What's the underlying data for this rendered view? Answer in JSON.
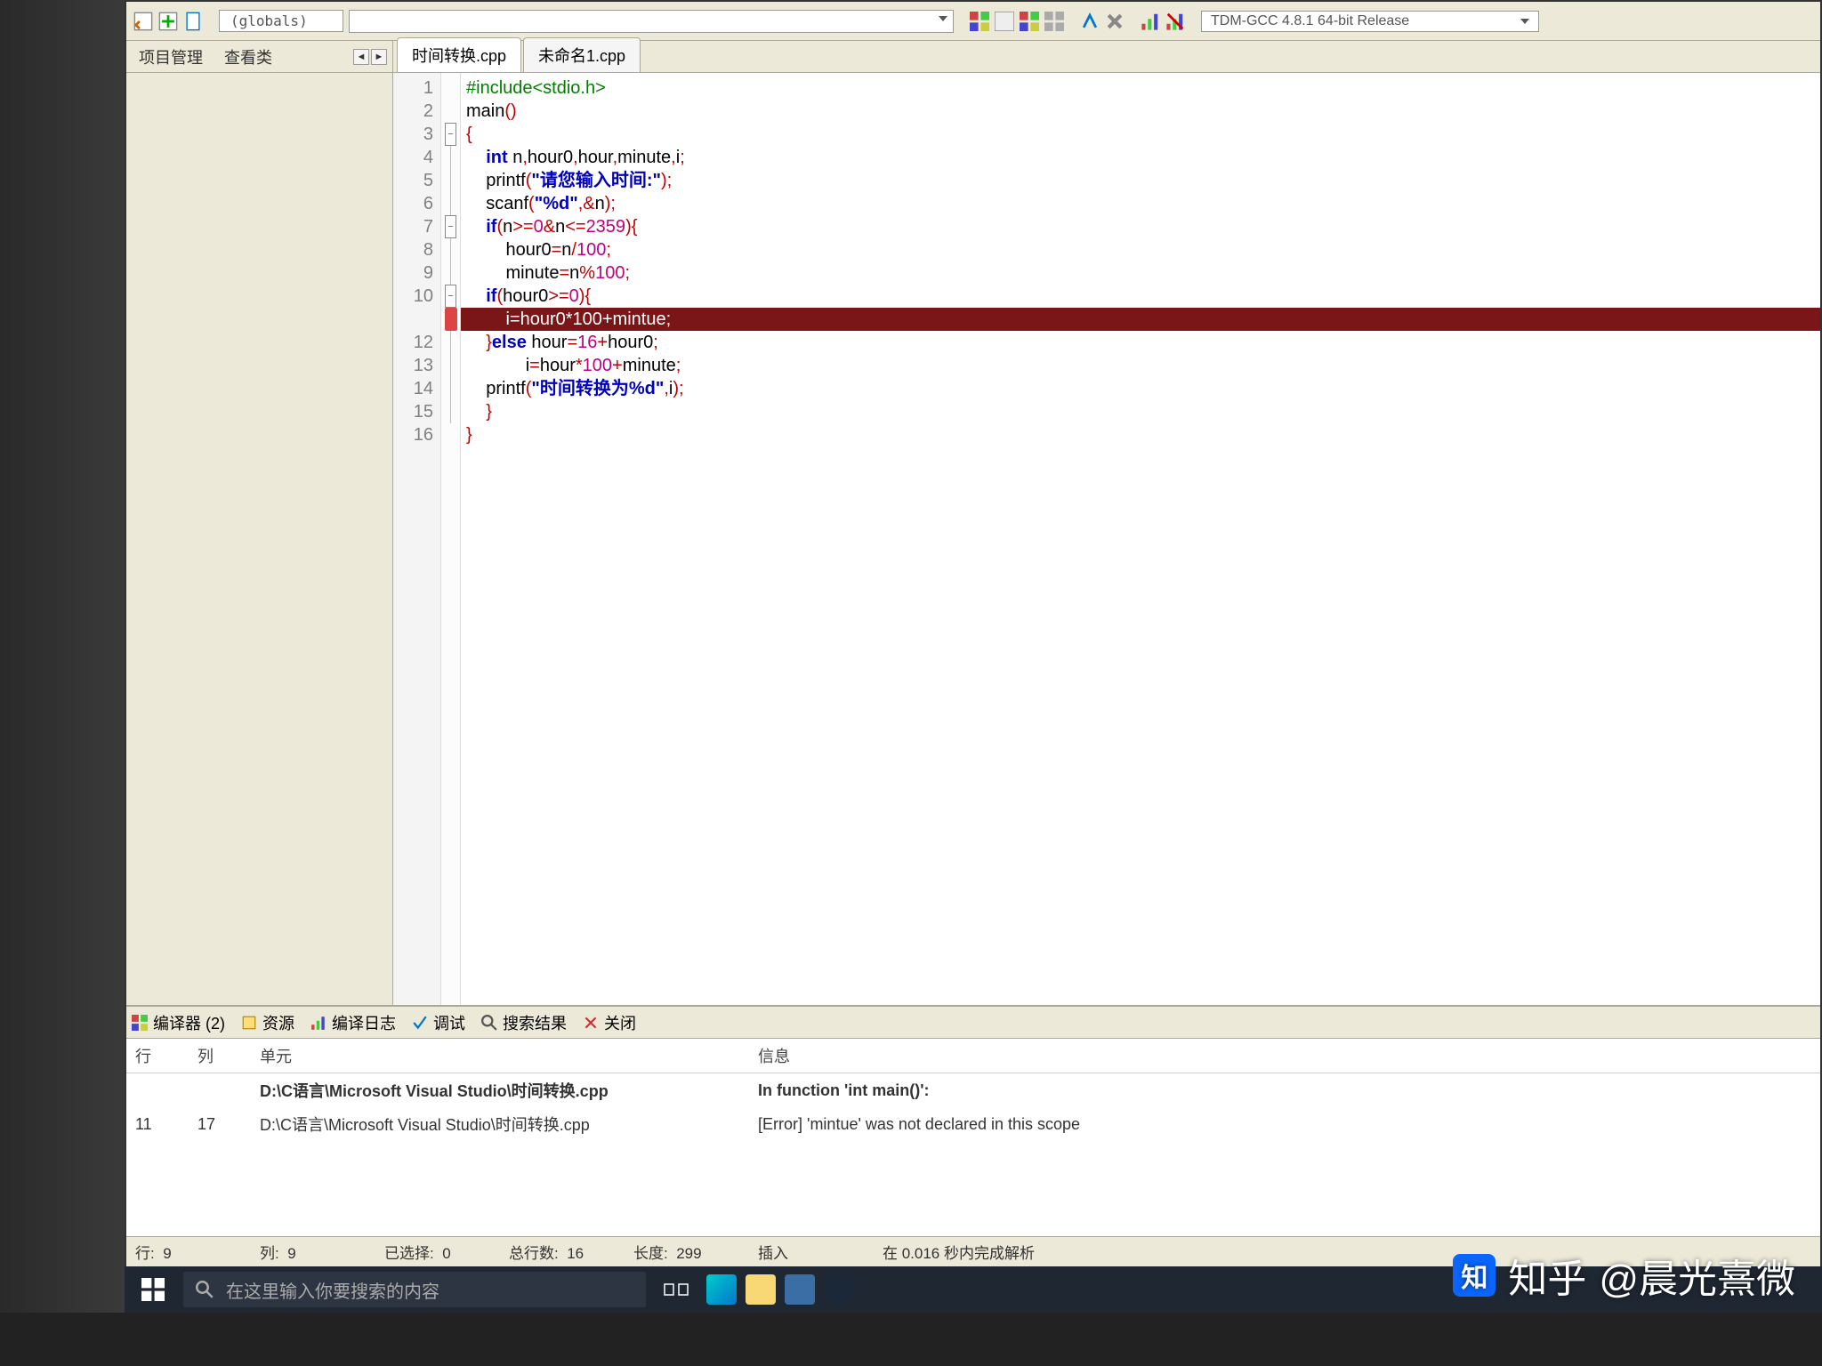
{
  "toolbar": {
    "globals": "(globals)",
    "compiler": "TDM-GCC 4.8.1 64-bit Release"
  },
  "sidebar": {
    "tab1": "项目管理",
    "tab2": "查看类"
  },
  "tabs": {
    "active": "时间转换.cpp",
    "other": "未命名1.cpp"
  },
  "code": {
    "lines": [
      {
        "n": "1",
        "fold": "",
        "html": "<span class='pp'>#include&lt;stdio.h&gt;</span>"
      },
      {
        "n": "2",
        "fold": "",
        "html": "<span class='fn'>main</span><span class='br'>()</span>"
      },
      {
        "n": "3",
        "fold": "box",
        "html": "<span class='br'>{</span>"
      },
      {
        "n": "4",
        "fold": "line",
        "html": "    <span class='kw'>int</span> <span class='id'>n</span><span class='op'>,</span><span class='id'>hour0</span><span class='op'>,</span><span class='id'>hour</span><span class='op'>,</span><span class='id'>minute</span><span class='op'>,</span><span class='id'>i</span><span class='op'>;</span>"
      },
      {
        "n": "5",
        "fold": "line",
        "html": "    <span class='fn'>printf</span><span class='br'>(</span><span class='str'>\"请您输入时间:\"</span><span class='br'>)</span><span class='op'>;</span>"
      },
      {
        "n": "6",
        "fold": "line",
        "html": "    <span class='fn'>scanf</span><span class='br'>(</span><span class='str'>\"%d\"</span><span class='op'>,&amp;</span><span class='id'>n</span><span class='br'>)</span><span class='op'>;</span>"
      },
      {
        "n": "7",
        "fold": "box",
        "html": "    <span class='kw'>if</span><span class='br'>(</span><span class='id'>n</span><span class='op'>&gt;=</span><span class='num'>0</span><span class='op'>&amp;</span><span class='id'>n</span><span class='op'>&lt;=</span><span class='num'>2359</span><span class='br'>){</span>"
      },
      {
        "n": "8",
        "fold": "line",
        "html": "        <span class='id'>hour0</span><span class='op'>=</span><span class='id'>n</span><span class='op'>/</span><span class='num'>100</span><span class='op'>;</span>"
      },
      {
        "n": "9",
        "fold": "line",
        "html": "        <span class='id'>minute</span><span class='op'>=</span><span class='id'>n</span><span class='op'>%</span><span class='num'>100</span><span class='op'>;</span>"
      },
      {
        "n": "10",
        "fold": "box",
        "html": "    <span class='kw'>if</span><span class='br'>(</span><span class='id'>hour0</span><span class='op'>&gt;=</span><span class='num'>0</span><span class='br'>){</span>"
      },
      {
        "n": "",
        "fold": "err",
        "err": true,
        "html": "        i=hour0*100+mintue;"
      },
      {
        "n": "12",
        "fold": "line",
        "html": "    <span class='br'>}</span><span class='kw'>else</span> <span class='id'>hour</span><span class='op'>=</span><span class='num'>16</span><span class='op'>+</span><span class='id'>hour0</span><span class='op'>;</span>"
      },
      {
        "n": "13",
        "fold": "line",
        "html": "            <span class='id'>i</span><span class='op'>=</span><span class='id'>hour</span><span class='op'>*</span><span class='num'>100</span><span class='op'>+</span><span class='id'>minute</span><span class='op'>;</span>"
      },
      {
        "n": "14",
        "fold": "line",
        "html": "    <span class='fn'>printf</span><span class='br'>(</span><span class='str'>\"时间转换为%d\"</span><span class='op'>,</span><span class='id'>i</span><span class='br'>)</span><span class='op'>;</span>"
      },
      {
        "n": "15",
        "fold": "line",
        "html": "    <span class='br'>}</span>"
      },
      {
        "n": "16",
        "fold": "",
        "html": "<span class='br'>}</span>"
      }
    ]
  },
  "panel": {
    "tabs": {
      "compiler": "编译器 (2)",
      "resource": "资源",
      "log": "编译日志",
      "debug": "调试",
      "search": "搜索结果",
      "close": "关闭"
    },
    "cols": {
      "line": "行",
      "col": "列",
      "unit": "单元",
      "info": "信息"
    },
    "rows": [
      {
        "line": "",
        "col": "",
        "unit": "D:\\C语言\\Microsoft Visual Studio\\时间转换.cpp",
        "info": "In function 'int main()':",
        "bold": true
      },
      {
        "line": "11",
        "col": "17",
        "unit": "D:\\C语言\\Microsoft Visual Studio\\时间转换.cpp",
        "info": "[Error] 'mintue' was not declared in this scope",
        "bold": false
      }
    ]
  },
  "status": {
    "line_lbl": "行:",
    "line": "9",
    "col_lbl": "列:",
    "col": "9",
    "sel_lbl": "已选择:",
    "sel": "0",
    "tot_lbl": "总行数:",
    "tot": "16",
    "len_lbl": "长度:",
    "len": "299",
    "ins": "插入",
    "done": "在 0.016 秒内完成解析"
  },
  "taskbar": {
    "search_placeholder": "在这里输入你要搜索的内容"
  },
  "watermark": {
    "site": "知乎",
    "user": "@晨光熹微"
  }
}
